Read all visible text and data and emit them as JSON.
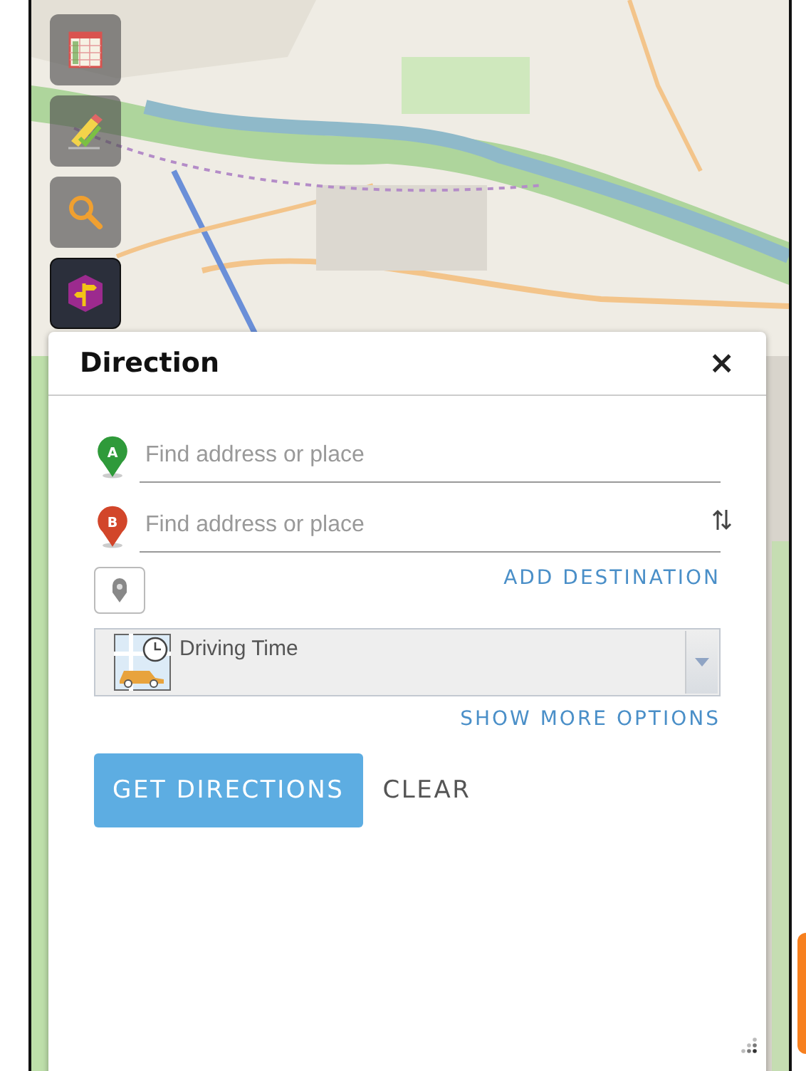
{
  "toolbar": [
    {
      "selected": false
    },
    {
      "selected": false
    },
    {
      "selected": false
    },
    {
      "selected": true
    }
  ],
  "panel": {
    "title": "Direction",
    "close": "×",
    "stops": [
      {
        "marker": "A",
        "color": "#2f9a3a",
        "placeholder": "Find address or place"
      },
      {
        "marker": "B",
        "color": "#d2462a",
        "placeholder": "Find address or place"
      }
    ],
    "add_destination": "ADD DESTINATION",
    "travel_mode": {
      "value": "Driving Time"
    },
    "show_more_options": "SHOW MORE OPTIONS",
    "get_directions": "GET DIRECTIONS",
    "clear": "CLEAR"
  }
}
